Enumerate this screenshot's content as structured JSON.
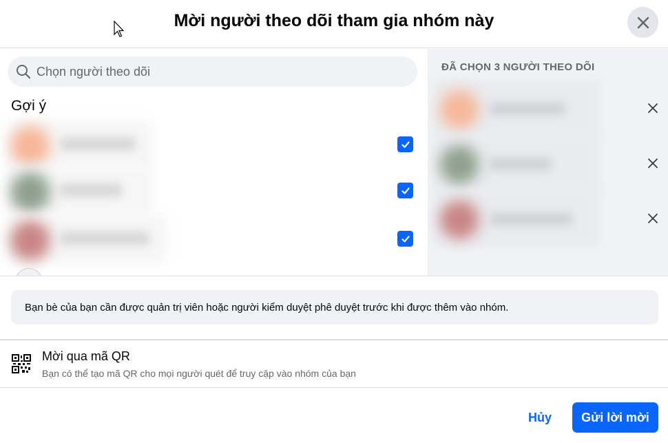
{
  "dialog": {
    "title": "Mời người theo dõi tham gia nhóm này",
    "close_icon": "close-icon"
  },
  "search": {
    "placeholder": "Chọn người theo dõi",
    "icon": "search-icon"
  },
  "suggestions": {
    "heading": "Gợi ý",
    "items": [
      {
        "checked": true,
        "avatar_color": "#f7b79a"
      },
      {
        "checked": true,
        "avatar_color": "#8fa08f"
      },
      {
        "checked": true,
        "avatar_color": "#c98585"
      }
    ]
  },
  "selected": {
    "heading": "ĐÃ CHỌN 3 NGƯỜI THEO DÕI",
    "items": [
      {
        "avatar_color": "#f7b79a"
      },
      {
        "avatar_color": "#8fa08f"
      },
      {
        "avatar_color": "#c98585"
      }
    ]
  },
  "notice": {
    "text": "Bạn bè của bạn cần được quản trị viên hoặc người kiểm duyệt phê duyệt trước khi được thêm vào nhóm."
  },
  "qr": {
    "title": "Mời qua mã QR",
    "subtitle": "Bạn có thể tạo mã QR cho mọi người quét để truy cập vào nhóm của bạn",
    "icon": "qr-code-icon"
  },
  "footer": {
    "cancel_label": "Hủy",
    "send_label": "Gửi lời mời"
  },
  "colors": {
    "accent": "#0866ff",
    "panel_bg": "#f0f2f5",
    "secondary_text": "#65676b"
  }
}
